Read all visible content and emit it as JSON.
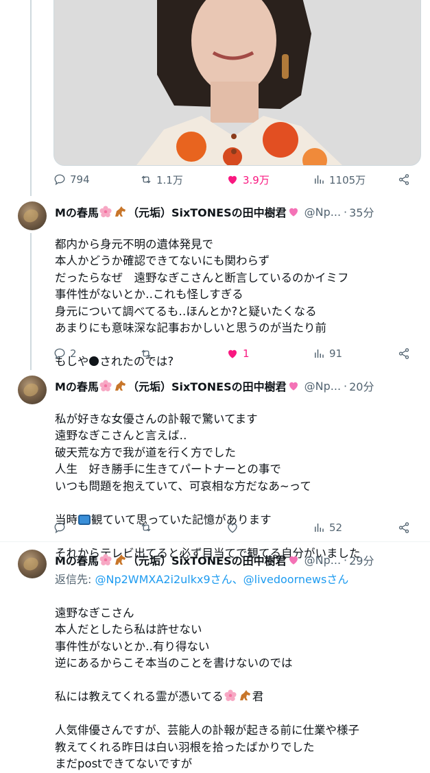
{
  "top_post": {
    "stats": {
      "replies": "794",
      "reposts": "1.1万",
      "likes": "3.9万",
      "views": "1105万"
    },
    "like_color": "#f91880"
  },
  "tweets": [
    {
      "name": "Mの春馬",
      "name_suffix": "（元垢）SixTONESの田中樹君",
      "handle": "@Np...",
      "time": "35分",
      "body": "都内から身元不明の遺体発見で\n本人かどうか確認できてないにも関わらず\nだったらなぜ　遠野なぎこさんと断言しているのかイミフ\n事件性がないとか‥これも怪しすぎる\n身元について調べてるも‥ほんとか?と疑いたくなる\nあまりにも意味深な記事おかしいと思うのが当たり前",
      "body_last_a": "もしや",
      "body_last_b": "されたのでは?",
      "replies": "2",
      "reposts": "",
      "likes": "1",
      "views": "91"
    },
    {
      "name": "Mの春馬",
      "name_suffix": "（元垢）SixTONESの田中樹君",
      "handle": "@Np...",
      "time": "20分",
      "body_a": "私が好きな女優さんの訃報で驚いてます\n遠野なぎこさんと言えば‥\n破天荒な方で我が道を行く方でした\n人生　好き勝手に生きてパートナーとの事で\nいつも問題を抱えていて、可哀相な方だなあ~って",
      "body_b_pre": "当時",
      "body_b_post": "観ていて思っていた記憶があります",
      "body_c": "それからテレビ出てると必ず目当てで観てる自分がいました",
      "replies": "",
      "reposts": "",
      "likes": "",
      "views": "52"
    },
    {
      "name": "Mの春馬",
      "name_suffix": "（元垢）SixTONESの田中樹君",
      "handle": "@Np...",
      "time": "29分",
      "reply_label": "返信先:",
      "reply_to": "@Np2WMXA2i2ulkx9さん、@livedoornewsさん",
      "body_a": "遠野なぎこさん\n本人だとしたら私は許せない\n事件性がないとか‥有り得ない\n逆にあるからこそ本当のことを書けないのでは",
      "body_b_pre": "私には教えてくれる霊が憑いてる",
      "body_b_post": "君",
      "body_c": "人気俳優さんですが、芸能人の訃報が起きる前に仕業や様子\n教えてくれる昨日は白い羽根を拾ったばかりでした\nまだpostできてないですが"
    }
  ]
}
